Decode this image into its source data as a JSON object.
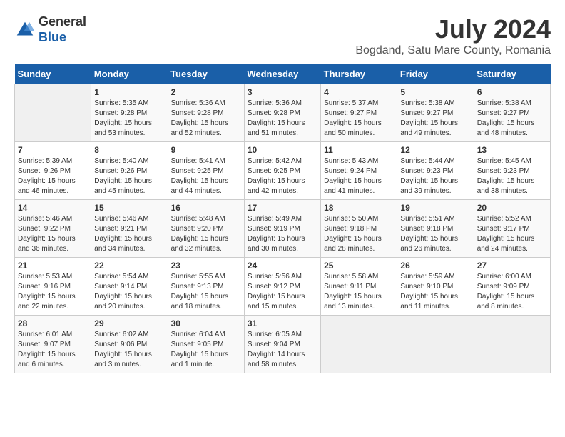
{
  "header": {
    "logo_line1": "General",
    "logo_line2": "Blue",
    "month": "July 2024",
    "location": "Bogdand, Satu Mare County, Romania"
  },
  "weekdays": [
    "Sunday",
    "Monday",
    "Tuesday",
    "Wednesday",
    "Thursday",
    "Friday",
    "Saturday"
  ],
  "weeks": [
    [
      {
        "day": "",
        "empty": true
      },
      {
        "day": "1",
        "sunrise": "5:35 AM",
        "sunset": "9:28 PM",
        "daylight": "15 hours and 53 minutes."
      },
      {
        "day": "2",
        "sunrise": "5:36 AM",
        "sunset": "9:28 PM",
        "daylight": "15 hours and 52 minutes."
      },
      {
        "day": "3",
        "sunrise": "5:36 AM",
        "sunset": "9:28 PM",
        "daylight": "15 hours and 51 minutes."
      },
      {
        "day": "4",
        "sunrise": "5:37 AM",
        "sunset": "9:27 PM",
        "daylight": "15 hours and 50 minutes."
      },
      {
        "day": "5",
        "sunrise": "5:38 AM",
        "sunset": "9:27 PM",
        "daylight": "15 hours and 49 minutes."
      },
      {
        "day": "6",
        "sunrise": "5:38 AM",
        "sunset": "9:27 PM",
        "daylight": "15 hours and 48 minutes."
      }
    ],
    [
      {
        "day": "7",
        "sunrise": "5:39 AM",
        "sunset": "9:26 PM",
        "daylight": "15 hours and 46 minutes."
      },
      {
        "day": "8",
        "sunrise": "5:40 AM",
        "sunset": "9:26 PM",
        "daylight": "15 hours and 45 minutes."
      },
      {
        "day": "9",
        "sunrise": "5:41 AM",
        "sunset": "9:25 PM",
        "daylight": "15 hours and 44 minutes."
      },
      {
        "day": "10",
        "sunrise": "5:42 AM",
        "sunset": "9:25 PM",
        "daylight": "15 hours and 42 minutes."
      },
      {
        "day": "11",
        "sunrise": "5:43 AM",
        "sunset": "9:24 PM",
        "daylight": "15 hours and 41 minutes."
      },
      {
        "day": "12",
        "sunrise": "5:44 AM",
        "sunset": "9:23 PM",
        "daylight": "15 hours and 39 minutes."
      },
      {
        "day": "13",
        "sunrise": "5:45 AM",
        "sunset": "9:23 PM",
        "daylight": "15 hours and 38 minutes."
      }
    ],
    [
      {
        "day": "14",
        "sunrise": "5:46 AM",
        "sunset": "9:22 PM",
        "daylight": "15 hours and 36 minutes."
      },
      {
        "day": "15",
        "sunrise": "5:46 AM",
        "sunset": "9:21 PM",
        "daylight": "15 hours and 34 minutes."
      },
      {
        "day": "16",
        "sunrise": "5:48 AM",
        "sunset": "9:20 PM",
        "daylight": "15 hours and 32 minutes."
      },
      {
        "day": "17",
        "sunrise": "5:49 AM",
        "sunset": "9:19 PM",
        "daylight": "15 hours and 30 minutes."
      },
      {
        "day": "18",
        "sunrise": "5:50 AM",
        "sunset": "9:18 PM",
        "daylight": "15 hours and 28 minutes."
      },
      {
        "day": "19",
        "sunrise": "5:51 AM",
        "sunset": "9:18 PM",
        "daylight": "15 hours and 26 minutes."
      },
      {
        "day": "20",
        "sunrise": "5:52 AM",
        "sunset": "9:17 PM",
        "daylight": "15 hours and 24 minutes."
      }
    ],
    [
      {
        "day": "21",
        "sunrise": "5:53 AM",
        "sunset": "9:16 PM",
        "daylight": "15 hours and 22 minutes."
      },
      {
        "day": "22",
        "sunrise": "5:54 AM",
        "sunset": "9:14 PM",
        "daylight": "15 hours and 20 minutes."
      },
      {
        "day": "23",
        "sunrise": "5:55 AM",
        "sunset": "9:13 PM",
        "daylight": "15 hours and 18 minutes."
      },
      {
        "day": "24",
        "sunrise": "5:56 AM",
        "sunset": "9:12 PM",
        "daylight": "15 hours and 15 minutes."
      },
      {
        "day": "25",
        "sunrise": "5:58 AM",
        "sunset": "9:11 PM",
        "daylight": "15 hours and 13 minutes."
      },
      {
        "day": "26",
        "sunrise": "5:59 AM",
        "sunset": "9:10 PM",
        "daylight": "15 hours and 11 minutes."
      },
      {
        "day": "27",
        "sunrise": "6:00 AM",
        "sunset": "9:09 PM",
        "daylight": "15 hours and 8 minutes."
      }
    ],
    [
      {
        "day": "28",
        "sunrise": "6:01 AM",
        "sunset": "9:07 PM",
        "daylight": "15 hours and 6 minutes."
      },
      {
        "day": "29",
        "sunrise": "6:02 AM",
        "sunset": "9:06 PM",
        "daylight": "15 hours and 3 minutes."
      },
      {
        "day": "30",
        "sunrise": "6:04 AM",
        "sunset": "9:05 PM",
        "daylight": "15 hours and 1 minute."
      },
      {
        "day": "31",
        "sunrise": "6:05 AM",
        "sunset": "9:04 PM",
        "daylight": "14 hours and 58 minutes."
      },
      {
        "day": "",
        "empty": true
      },
      {
        "day": "",
        "empty": true
      },
      {
        "day": "",
        "empty": true
      }
    ]
  ]
}
